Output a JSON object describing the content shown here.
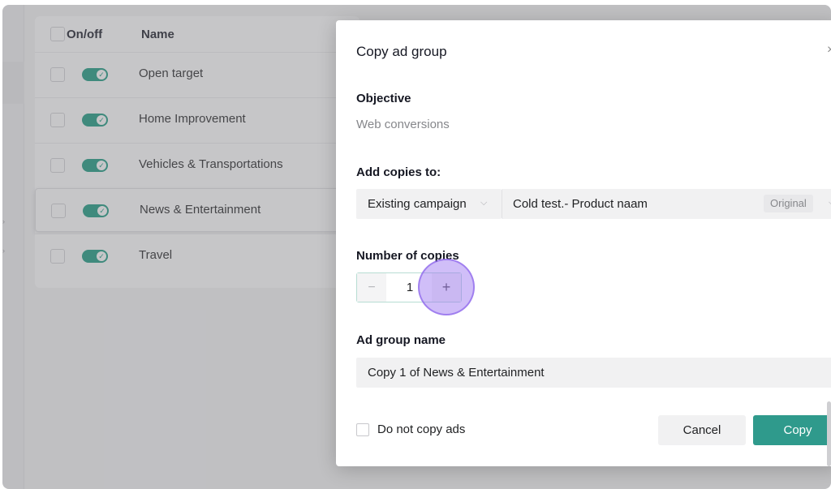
{
  "table": {
    "header": {
      "on_off": "On/off",
      "name": "Name"
    },
    "rows": [
      {
        "name": "Open target",
        "enabled": true
      },
      {
        "name": "Home Improvement",
        "enabled": true
      },
      {
        "name": "Vehicles & Transportations",
        "enabled": true
      },
      {
        "name": "News & Entertainment",
        "enabled": true
      },
      {
        "name": "Travel",
        "enabled": true
      }
    ]
  },
  "modal": {
    "title": "Copy ad group",
    "objective_label": "Objective",
    "objective_value": "Web conversions",
    "add_copies_label": "Add copies to:",
    "campaign_type": "Existing campaign",
    "campaign_name": "Cold test.- Product naam",
    "campaign_badge": "Original",
    "copies_label": "Number of copies",
    "copies_value": "1",
    "minus_symbol": "−",
    "plus_symbol": "+",
    "ad_group_name_label": "Ad group name",
    "ad_group_name_value": "Copy 1 of News & Entertainment",
    "do_not_copy_ads_label": "Do not copy ads",
    "cancel_label": "Cancel",
    "copy_label": "Copy",
    "close_symbol": "×"
  },
  "icons": {
    "toggle_check": "✓",
    "chevron": "⌵"
  },
  "colors": {
    "accent": "#2f9a8c",
    "toggle_on": "#17987e",
    "click_highlight": "#966ef0"
  }
}
